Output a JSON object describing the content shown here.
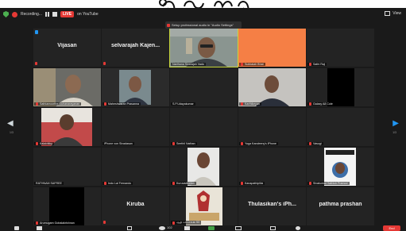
{
  "topbar": {
    "recording_label": "Recording...",
    "live_badge": "LIVE",
    "youtube_label": "on YouTube",
    "view_label": "View"
  },
  "toast": {
    "text": "Setup professional audio in \"Audio Settings\""
  },
  "tiles": [
    {
      "label": "Vijasan",
      "type": "name"
    },
    {
      "label": "selvarajah Kajen...",
      "type": "name"
    },
    {
      "label": "Narthana Sivarajah Vado",
      "type": "video"
    },
    {
      "label": "Subbaiah Bhat",
      "type": "orange"
    },
    {
      "label": "Sathi Raji",
      "type": "empty"
    },
    {
      "label": "Sathiamoorthe Guhanarayanan",
      "type": "video"
    },
    {
      "label": "Maheshwaran Prasanna",
      "type": "video"
    },
    {
      "label": "S.P.Udayakumar",
      "type": "empty"
    },
    {
      "label": "Karthikeyan",
      "type": "video"
    },
    {
      "label": "Galaxy A8 Cole",
      "type": "black"
    },
    {
      "label": "Kalaivikky",
      "type": "video"
    },
    {
      "label": "iPhone von Sivadasan",
      "type": "empty"
    },
    {
      "label": "Seethil Nathan",
      "type": "empty"
    },
    {
      "label": "Yoga Kandeeny's iPhone",
      "type": "empty"
    },
    {
      "label": "Vasugi",
      "type": "empty"
    },
    {
      "label": "RATHNAM SAFREE",
      "type": "empty"
    },
    {
      "label": "Indo Lal Fernando",
      "type": "empty"
    },
    {
      "label": "Kuruvadivelan",
      "type": "video"
    },
    {
      "label": "Kanapathipillai",
      "type": "empty"
    },
    {
      "label": "Sivakumar Sathish Pramod",
      "type": "poster"
    },
    {
      "label": "Arumugam Gobalakrishnan",
      "type": "black"
    },
    {
      "label": "Kiruba",
      "type": "name"
    },
    {
      "label": "ஆதி கரிகாலன் 53",
      "type": "video"
    },
    {
      "label": "Thulasikan's iPh...",
      "type": "name"
    },
    {
      "label": "pathma prashan",
      "type": "name"
    }
  ],
  "navigation": {
    "left_page": "1/3",
    "right_page": "1/3"
  },
  "toolbar": {
    "participants_count": "102",
    "end_label": "End"
  },
  "colors": {
    "accent_red": "#e53935",
    "active_border": "#c8d63b",
    "orange_tile": "#f57f45",
    "nav_blue": "#2196f3"
  }
}
